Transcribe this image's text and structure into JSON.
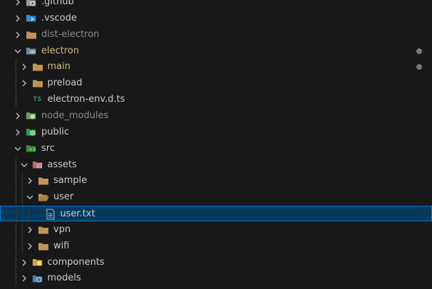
{
  "explorer": {
    "items": [
      {
        "label": ".github",
        "kind": "folder-github",
        "state": "collapsed",
        "depth": 0,
        "style": "normal",
        "icon": "github-folder-icon"
      },
      {
        "label": ".vscode",
        "kind": "folder-vscode",
        "state": "collapsed",
        "depth": 0,
        "style": "normal",
        "icon": "vscode-folder-icon"
      },
      {
        "label": "dist-electron",
        "kind": "folder",
        "state": "collapsed",
        "depth": 0,
        "style": "dim",
        "icon": "folder-icon"
      },
      {
        "label": "electron",
        "kind": "folder-electron",
        "state": "expanded",
        "depth": 0,
        "style": "yellow",
        "icon": "electron-folder-open-icon",
        "modified": true
      },
      {
        "label": "main",
        "kind": "folder",
        "state": "collapsed",
        "depth": 1,
        "style": "yellow",
        "icon": "folder-icon",
        "modified": true
      },
      {
        "label": "preload",
        "kind": "folder",
        "state": "collapsed",
        "depth": 1,
        "style": "normal",
        "icon": "folder-icon"
      },
      {
        "label": "electron-env.d.ts",
        "kind": "file-ts",
        "state": "none",
        "depth": 1,
        "style": "normal",
        "icon": "typescript-file-icon"
      },
      {
        "label": "node_modules",
        "kind": "folder-node",
        "state": "collapsed",
        "depth": 0,
        "style": "dim",
        "icon": "node-modules-folder-icon"
      },
      {
        "label": "public",
        "kind": "folder-public",
        "state": "collapsed",
        "depth": 0,
        "style": "normal",
        "icon": "public-folder-icon"
      },
      {
        "label": "src",
        "kind": "folder-src",
        "state": "expanded",
        "depth": 0,
        "style": "normal",
        "icon": "src-folder-open-icon"
      },
      {
        "label": "assets",
        "kind": "folder-assets",
        "state": "expanded",
        "depth": 1,
        "style": "normal",
        "icon": "assets-folder-open-icon"
      },
      {
        "label": "sample",
        "kind": "folder",
        "state": "collapsed",
        "depth": 2,
        "style": "normal",
        "icon": "folder-icon"
      },
      {
        "label": "user",
        "kind": "folder-open",
        "state": "expanded",
        "depth": 2,
        "style": "normal",
        "icon": "folder-open-icon"
      },
      {
        "label": "user.txt",
        "kind": "file-txt",
        "state": "none",
        "depth": 3,
        "style": "selected",
        "icon": "text-file-icon"
      },
      {
        "label": "vpn",
        "kind": "folder",
        "state": "collapsed",
        "depth": 2,
        "style": "normal",
        "icon": "folder-icon"
      },
      {
        "label": "wifi",
        "kind": "folder",
        "state": "collapsed",
        "depth": 2,
        "style": "normal",
        "icon": "folder-icon"
      },
      {
        "label": "components",
        "kind": "folder-components",
        "state": "collapsed",
        "depth": 1,
        "style": "normal",
        "icon": "components-folder-icon"
      },
      {
        "label": "models",
        "kind": "folder-models",
        "state": "collapsed",
        "depth": 1,
        "style": "normal",
        "icon": "models-folder-icon"
      }
    ],
    "ts_badge": "TS",
    "colors": {
      "background": "#181818",
      "text": "#cccccc",
      "dim_text": "#8b8b8b",
      "modified_text": "#d7ba7d",
      "selection_bg": "#04395e",
      "selection_border": "#0078d4",
      "folder": "#c09553"
    }
  }
}
